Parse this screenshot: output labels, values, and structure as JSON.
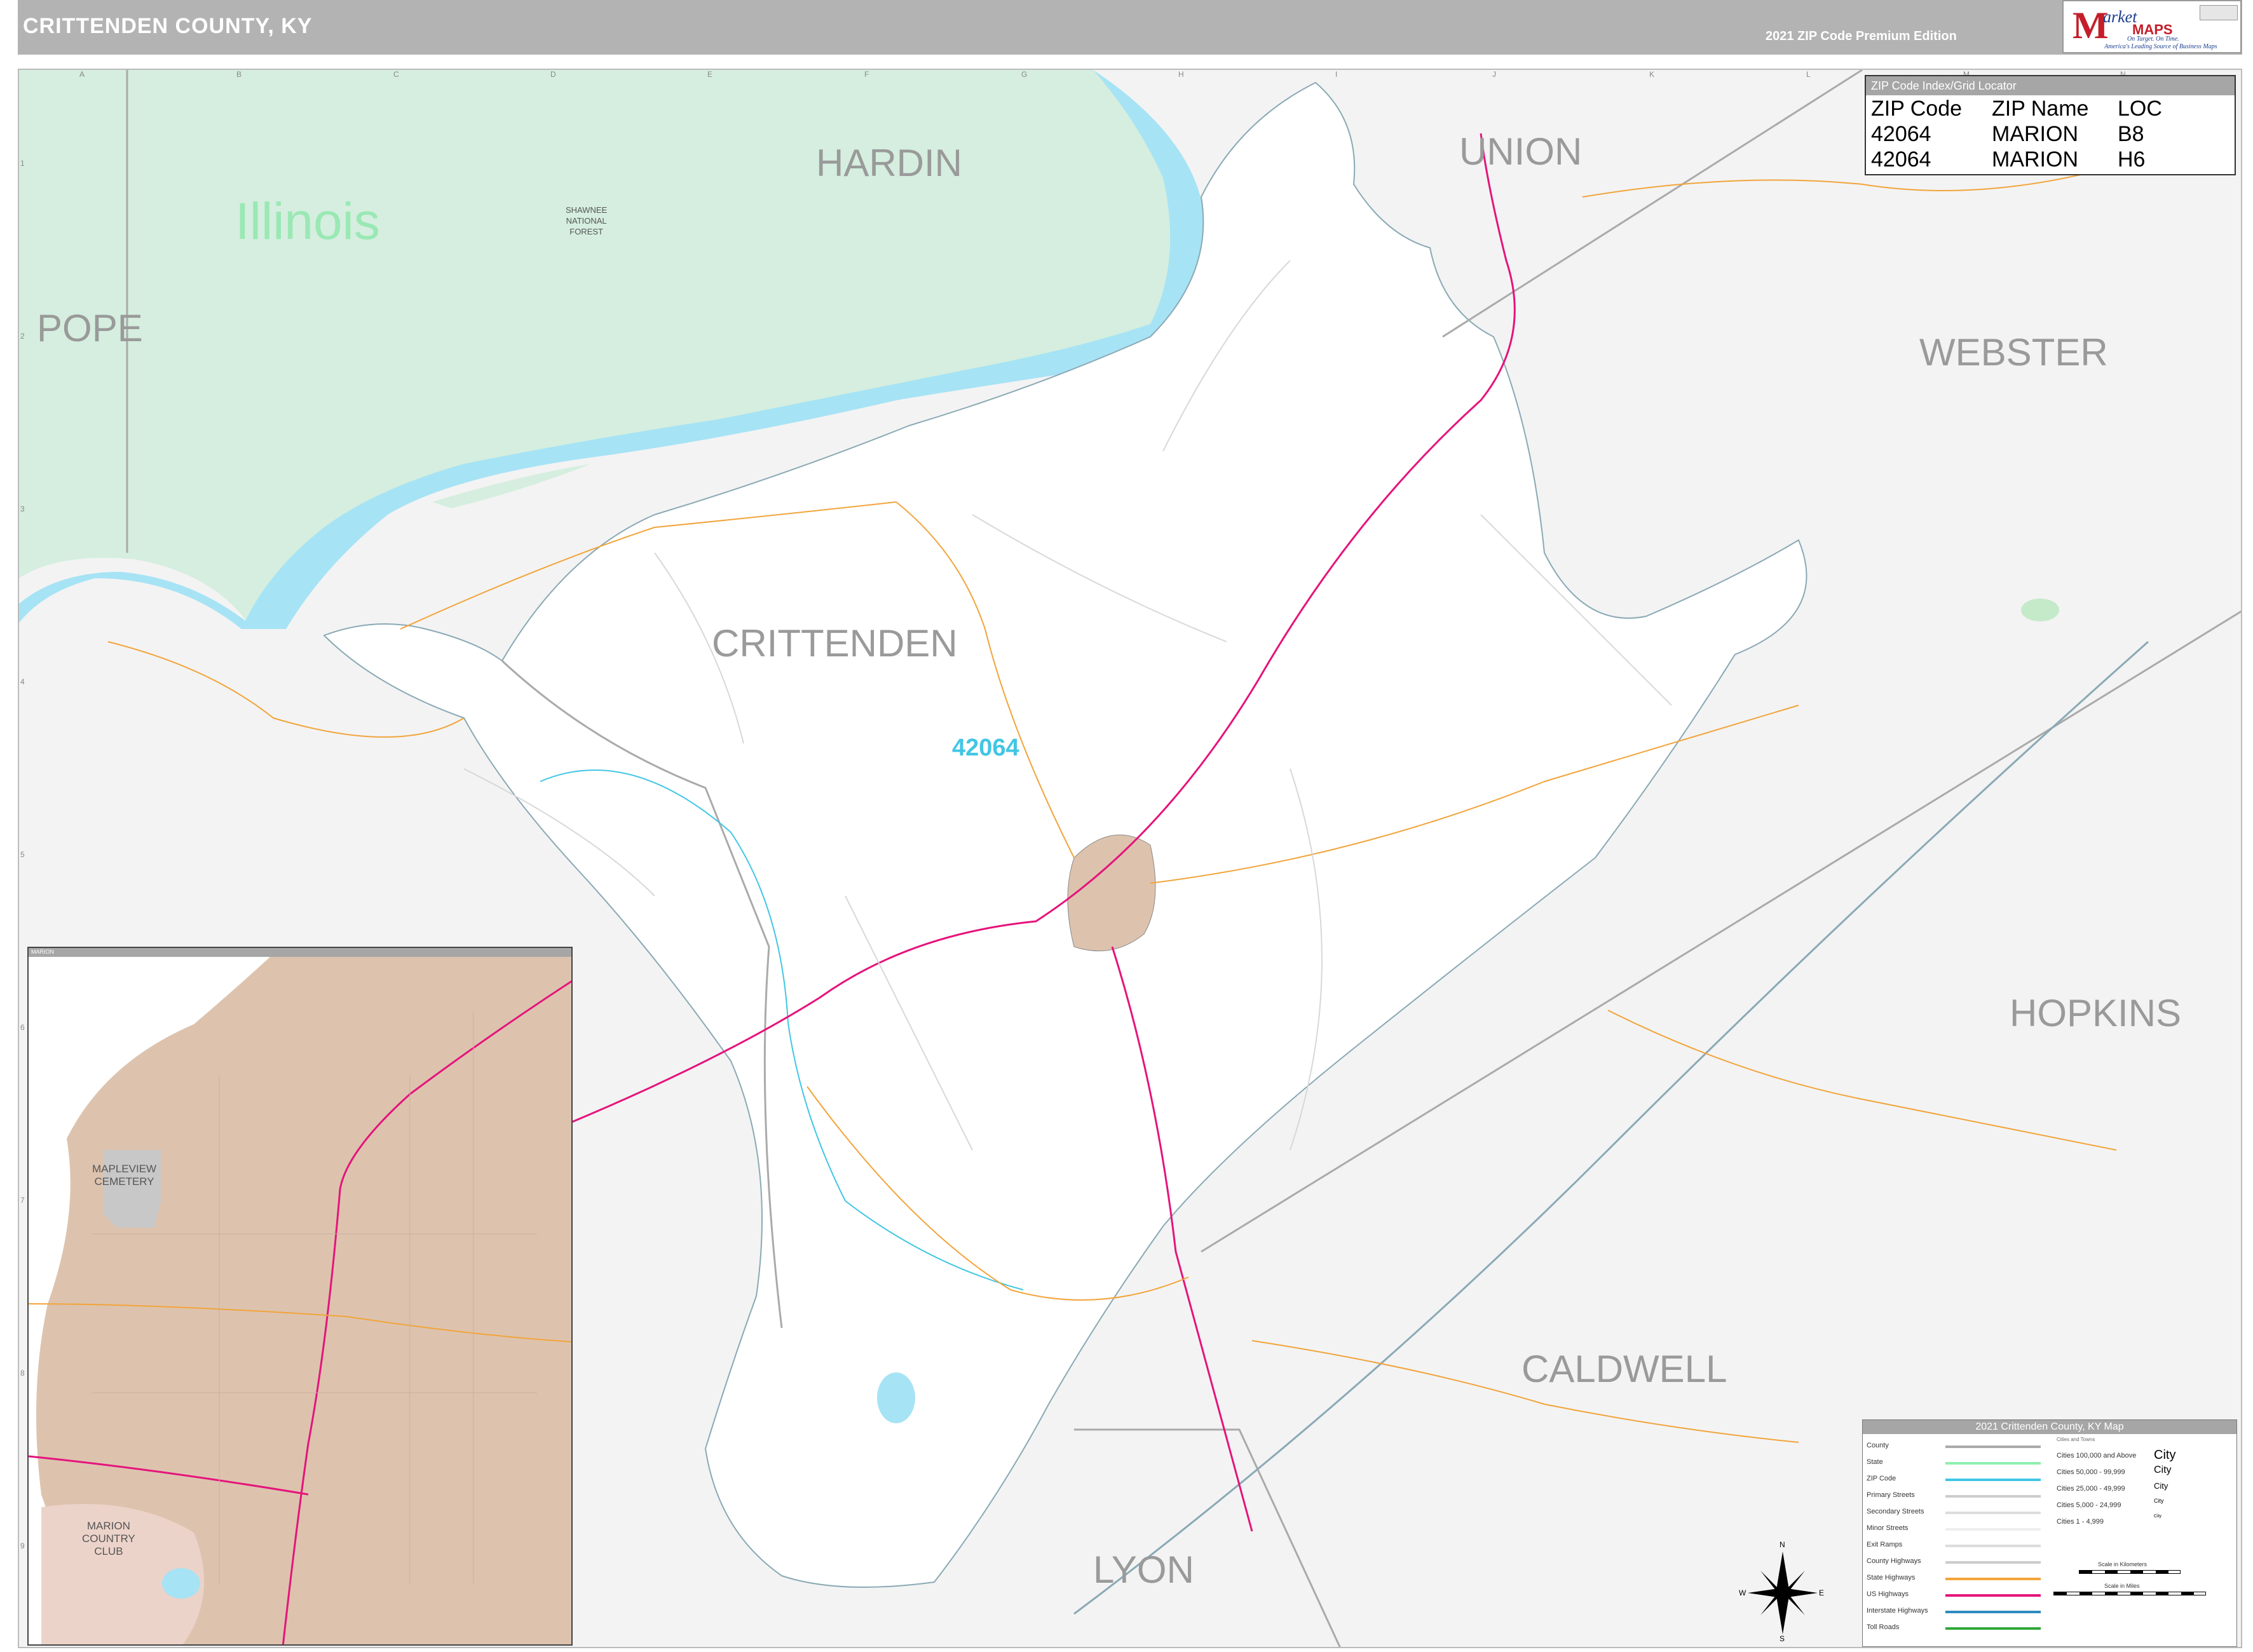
{
  "header": {
    "title": "CRITTENDEN COUNTY, KY",
    "edition": "2021 ZIP Code Premium Edition"
  },
  "logo": {
    "m": "M",
    "arket": "arket",
    "maps": "MAPS",
    "tagline1": "On Target. On Time.",
    "tagline2": "America's Leading Source of Business Maps"
  },
  "grid": {
    "letters": [
      "A",
      "B",
      "C",
      "D",
      "E",
      "F",
      "G",
      "H",
      "I",
      "J",
      "K",
      "L",
      "M",
      "N"
    ],
    "numbers": [
      "1",
      "2",
      "3",
      "4",
      "5",
      "6",
      "7",
      "8",
      "9"
    ]
  },
  "regions": {
    "hardin": "HARDIN",
    "union": "UNION",
    "webster": "WEBSTER",
    "pope": "POPE",
    "crittenden": "CRITTENDEN",
    "hopkins": "HOPKINS",
    "caldwell": "CALDWELL",
    "lyon": "LYON",
    "illinois": "Illinois"
  },
  "forest": [
    "SHAWNEE",
    "NATIONAL",
    "FOREST"
  ],
  "zip_area_label": "42064",
  "zip_table": {
    "caption": "ZIP Code Index/Grid Locator",
    "headers": [
      "ZIP Code",
      "ZIP Name",
      "LOC"
    ],
    "rows": [
      [
        "42064",
        "MARION",
        "B8"
      ],
      [
        "42064",
        "MARION",
        "H6"
      ]
    ]
  },
  "inset": {
    "title": "MARION",
    "cemetery": [
      "MAPLEVIEW",
      "CEMETERY"
    ],
    "club": [
      "MARION",
      "COUNTRY",
      "CLUB"
    ]
  },
  "legend": {
    "title": "2021 Crittenden County, KY Map",
    "subtitle": "Cities and Towns",
    "items": [
      {
        "label": "County",
        "color": "#aaaaaa"
      },
      {
        "label": "State",
        "color": "#8df0ae"
      },
      {
        "label": "ZIP Code",
        "color": "#41c6e4"
      },
      {
        "label": "Primary Streets",
        "color": "#cccccc"
      },
      {
        "label": "Secondary Streets",
        "color": "#dddddd"
      },
      {
        "label": "Minor Streets",
        "color": "#eeeeee"
      },
      {
        "label": "Exit Ramps",
        "color": "#dddddd"
      },
      {
        "label": "County Highways",
        "color": "#cccccc"
      },
      {
        "label": "State Highways",
        "color": "#f2a43a"
      },
      {
        "label": "US Highways",
        "color": "#e5147c"
      },
      {
        "label": "Interstate Highways",
        "color": "#2d8bbd"
      },
      {
        "label": "Toll Roads",
        "color": "#31a83b"
      }
    ],
    "populations": [
      {
        "label": "Cities 100,000 and Above",
        "sample": "City"
      },
      {
        "label": "Cities 50,000 - 99,999",
        "sample": "City"
      },
      {
        "label": "Cities 25,000 - 49,999",
        "sample": "City"
      },
      {
        "label": "Cities 5,000 - 24,999",
        "sample": "City"
      },
      {
        "label": "Cities 1 - 4,999",
        "sample": "City"
      }
    ],
    "scale_km": "Scale in Kilometers",
    "scale_mi": "Scale in Miles"
  },
  "compass": {
    "n": "N",
    "s": "S",
    "e": "E",
    "w": "W"
  },
  "colors": {
    "water": "#a6e3f5",
    "illinois_fill": "#d5eedf",
    "county_fill": "#ffffff",
    "outside_fill": "#f3f3f3",
    "town_fill": "#ddc3ae",
    "us_highway": "#e5147c",
    "state_highway": "#f2a43a",
    "interstate": "#8aa9b5",
    "zip_boundary": "#41c6e4"
  }
}
